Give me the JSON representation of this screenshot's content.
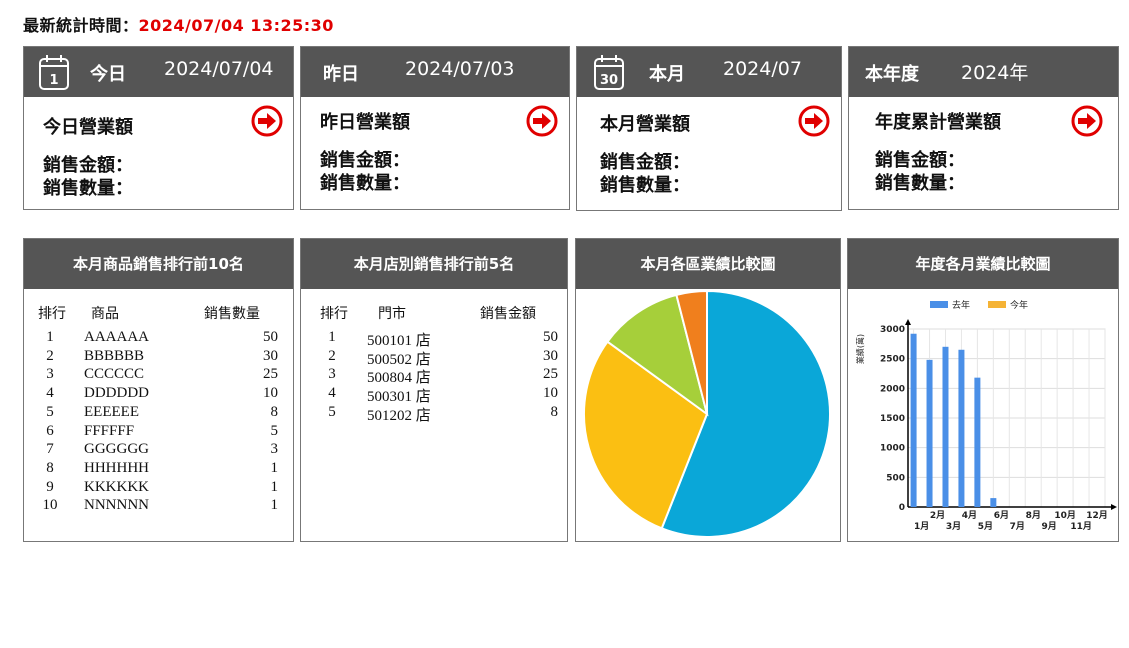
{
  "stat": {
    "label": "最新統計時間：",
    "time": "2024/07/04 13:25:30"
  },
  "cards": [
    {
      "label": "今日",
      "date": "2024/07/04",
      "icon": "calendar-icon",
      "icon_text": "1",
      "title": "今日營業額",
      "amount_label": "銷售金額：",
      "qty_label": "銷售數量："
    },
    {
      "label": "昨日",
      "date": "2024/07/03",
      "title": "昨日營業額",
      "amount_label": "銷售金額：",
      "qty_label": "銷售數量："
    },
    {
      "label": "本月",
      "date": "2024/07",
      "icon": "calendar-icon",
      "icon_text": "30",
      "title": "本月營業額",
      "amount_label": "銷售金額：",
      "qty_label": "銷售數量："
    },
    {
      "label": "本年度",
      "date": "2024年",
      "title": "年度累計營業額",
      "amount_label": "銷售金額：",
      "qty_label": "銷售數量："
    }
  ],
  "product_rank": {
    "title": "本月商品銷售排行前10名",
    "headers": [
      "排行",
      "商品",
      "銷售數量"
    ],
    "rows": [
      [
        "1",
        "AAAAAA",
        "50"
      ],
      [
        "2",
        "BBBBBB",
        "30"
      ],
      [
        "3",
        "CCCCCC",
        "25"
      ],
      [
        "4",
        "DDDDDD",
        "10"
      ],
      [
        "5",
        "EEEEEE",
        "8"
      ],
      [
        "6",
        "FFFFFF",
        "5"
      ],
      [
        "7",
        "GGGGGG",
        "3"
      ],
      [
        "8",
        "HHHHHH",
        "1"
      ],
      [
        "9",
        "KKKKKK",
        "1"
      ],
      [
        "10",
        "NNNNNN",
        "1"
      ]
    ]
  },
  "store_rank": {
    "title": "本月店別銷售排行前5名",
    "headers": [
      "排行",
      "門市",
      "銷售金額"
    ],
    "rows": [
      [
        "1",
        "500101 店",
        "50"
      ],
      [
        "2",
        "500502 店",
        "30"
      ],
      [
        "3",
        "500804 店",
        "25"
      ],
      [
        "4",
        "500301 店",
        "10"
      ],
      [
        "5",
        "501202 店",
        "8"
      ]
    ]
  },
  "pie_panel": {
    "title": "本月各區業績比較圖"
  },
  "bar_panel": {
    "title": "年度各月業績比較圖"
  },
  "chart_data": [
    {
      "type": "pie",
      "values": [
        56,
        29,
        11,
        4
      ],
      "colors": [
        "#0aa7d8",
        "#fbbf12",
        "#a6cf3a",
        "#f07f1d"
      ]
    },
    {
      "type": "bar",
      "ylabel": "業績(萬)",
      "ylim": [
        0,
        3000
      ],
      "yticks": [
        0,
        500,
        1000,
        1500,
        2000,
        2500,
        3000
      ],
      "categories": [
        "1月",
        "2月",
        "3月",
        "4月",
        "5月",
        "6月",
        "7月",
        "8月",
        "9月",
        "10月",
        "11月",
        "12月"
      ],
      "series": [
        {
          "name": "去年",
          "color": "#4a8fe7",
          "values": [
            2920,
            2480,
            2700,
            2650,
            2180,
            150,
            0,
            0,
            0,
            0,
            0,
            0
          ]
        },
        {
          "name": "今年",
          "color": "#f5b335",
          "values": [
            0,
            0,
            0,
            0,
            0,
            0,
            0,
            0,
            0,
            0,
            0,
            0
          ]
        }
      ],
      "legend": "top"
    }
  ]
}
